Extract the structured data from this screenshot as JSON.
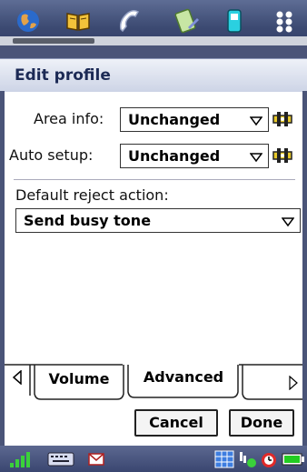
{
  "dialog": {
    "title": "Edit profile"
  },
  "fields": {
    "area_info": {
      "label": "Area info:",
      "value": "Unchanged"
    },
    "auto_setup": {
      "label": "Auto setup:",
      "value": "Unchanged"
    },
    "default_reject": {
      "label": "Default reject action:",
      "value": "Send busy tone"
    }
  },
  "tabs": [
    {
      "label": "Volume",
      "selected": false
    },
    {
      "label": "Advanced",
      "selected": true
    }
  ],
  "buttons": {
    "cancel": "Cancel",
    "done": "Done"
  },
  "icons": {
    "launcher": [
      "globe-icon",
      "book-icon",
      "phone-icon",
      "pen-icon",
      "handset-icon",
      "apps-grid-icon"
    ],
    "status": [
      "signal-icon",
      "keyboard-icon",
      "message-icon",
      "calendar-icon",
      "connection-icon",
      "alarm-icon",
      "battery-icon"
    ]
  },
  "colors": {
    "title_text": "#1c2a55",
    "bar": "#3c4a72",
    "battery": "#22cc22"
  }
}
